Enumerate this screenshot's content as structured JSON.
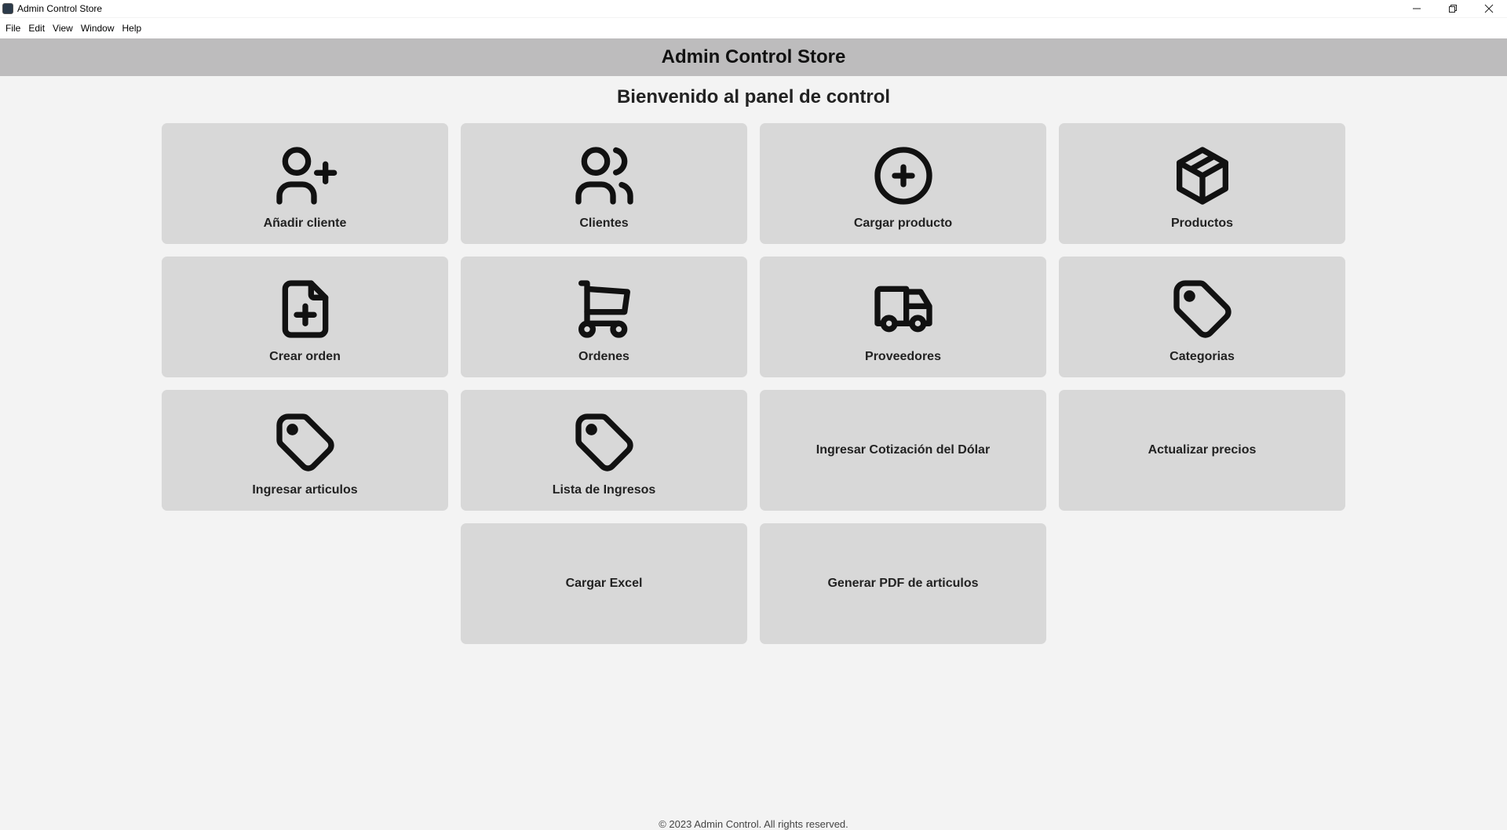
{
  "window": {
    "title": "Admin Control Store",
    "controls": [
      "minimize-icon",
      "restore-icon",
      "close-icon"
    ]
  },
  "menu": [
    "File",
    "Edit",
    "View",
    "Window",
    "Help"
  ],
  "header": {
    "title": "Admin Control Store"
  },
  "welcome": "Bienvenido al panel de control",
  "tiles": [
    {
      "label": "Añadir cliente",
      "icon": "user-plus-icon"
    },
    {
      "label": "Clientes",
      "icon": "users-icon"
    },
    {
      "label": "Cargar producto",
      "icon": "circle-plus-icon"
    },
    {
      "label": "Productos",
      "icon": "box-icon"
    },
    {
      "label": "Crear orden",
      "icon": "file-plus-icon"
    },
    {
      "label": "Ordenes",
      "icon": "shopping-cart-icon"
    },
    {
      "label": "Proveedores",
      "icon": "truck-icon"
    },
    {
      "label": "Categorias",
      "icon": "tag-icon"
    },
    {
      "label": "Ingresar articulos",
      "icon": "tag-icon"
    },
    {
      "label": "Lista de Ingresos",
      "icon": "tag-icon"
    },
    {
      "label": "Ingresar Cotización del Dólar"
    },
    {
      "label": "Actualizar precios"
    },
    {
      "label": "Cargar Excel"
    },
    {
      "label": "Generar PDF de articulos"
    }
  ],
  "footer": "© 2023 Admin Control. All rights reserved."
}
